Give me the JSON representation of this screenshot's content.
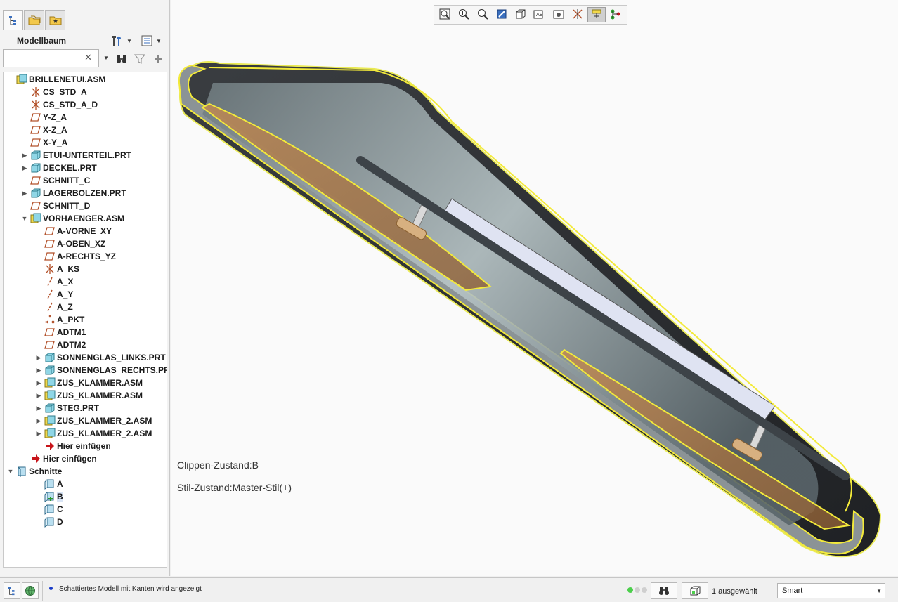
{
  "panel": {
    "title": "Modellbaum",
    "search": {
      "value": "",
      "placeholder": ""
    }
  },
  "tree": [
    {
      "label": "BRILLENETUI.ASM",
      "icon": "assembly",
      "depth": 0,
      "toggle": ""
    },
    {
      "label": "CS_STD_A",
      "icon": "csys",
      "depth": 1,
      "toggle": ""
    },
    {
      "label": "CS_STD_A_D",
      "icon": "csys",
      "depth": 1,
      "toggle": ""
    },
    {
      "label": "Y-Z_A",
      "icon": "datum-plane",
      "depth": 1,
      "toggle": ""
    },
    {
      "label": "X-Z_A",
      "icon": "datum-plane",
      "depth": 1,
      "toggle": ""
    },
    {
      "label": "X-Y_A",
      "icon": "datum-plane",
      "depth": 1,
      "toggle": ""
    },
    {
      "label": "ETUI-UNTERTEIL.PRT",
      "icon": "part",
      "depth": 1,
      "toggle": "collapsed"
    },
    {
      "label": "DECKEL.PRT",
      "icon": "part",
      "depth": 1,
      "toggle": "collapsed"
    },
    {
      "label": "SCHNITT_C",
      "icon": "datum-plane",
      "depth": 1,
      "toggle": ""
    },
    {
      "label": "LAGERBOLZEN.PRT",
      "icon": "part",
      "depth": 1,
      "toggle": "collapsed"
    },
    {
      "label": "SCHNITT_D",
      "icon": "datum-plane",
      "depth": 1,
      "toggle": ""
    },
    {
      "label": "VORHAENGER.ASM",
      "icon": "assembly",
      "depth": 1,
      "toggle": "expanded"
    },
    {
      "label": "A-VORNE_XY",
      "icon": "datum-plane",
      "depth": 2,
      "toggle": ""
    },
    {
      "label": "A-OBEN_XZ",
      "icon": "datum-plane",
      "depth": 2,
      "toggle": ""
    },
    {
      "label": "A-RECHTS_YZ",
      "icon": "datum-plane",
      "depth": 2,
      "toggle": ""
    },
    {
      "label": "A_KS",
      "icon": "csys",
      "depth": 2,
      "toggle": ""
    },
    {
      "label": "A_X",
      "icon": "axis",
      "depth": 2,
      "toggle": ""
    },
    {
      "label": "A_Y",
      "icon": "axis",
      "depth": 2,
      "toggle": ""
    },
    {
      "label": "A_Z",
      "icon": "axis",
      "depth": 2,
      "toggle": ""
    },
    {
      "label": "A_PKT",
      "icon": "point",
      "depth": 2,
      "toggle": ""
    },
    {
      "label": "ADTM1",
      "icon": "datum-plane",
      "depth": 2,
      "toggle": ""
    },
    {
      "label": "ADTM2",
      "icon": "datum-plane",
      "depth": 2,
      "toggle": ""
    },
    {
      "label": "SONNENGLAS_LINKS.PRT",
      "icon": "part",
      "depth": 2,
      "toggle": "collapsed"
    },
    {
      "label": "SONNENGLAS_RECHTS.PRT",
      "icon": "part",
      "depth": 2,
      "toggle": "collapsed"
    },
    {
      "label": "ZUS_KLAMMER.ASM",
      "icon": "assembly",
      "depth": 2,
      "toggle": "collapsed"
    },
    {
      "label": "ZUS_KLAMMER.ASM",
      "icon": "assembly",
      "depth": 2,
      "toggle": "collapsed"
    },
    {
      "label": "STEG.PRT",
      "icon": "part",
      "depth": 2,
      "toggle": "collapsed"
    },
    {
      "label": "ZUS_KLAMMER_2.ASM",
      "icon": "assembly",
      "depth": 2,
      "toggle": "collapsed"
    },
    {
      "label": "ZUS_KLAMMER_2.ASM",
      "icon": "assembly",
      "depth": 2,
      "toggle": "collapsed"
    },
    {
      "label": "Hier einfügen",
      "icon": "insert-arrow",
      "depth": 2,
      "toggle": ""
    },
    {
      "label": "Hier einfügen",
      "icon": "insert-arrow",
      "depth": 1,
      "toggle": ""
    },
    {
      "label": "Schnitte",
      "icon": "section-folder",
      "depth": 0,
      "toggle": "expanded"
    },
    {
      "label": "A",
      "icon": "section",
      "depth": 2,
      "toggle": ""
    },
    {
      "label": "B",
      "icon": "section-active",
      "depth": 2,
      "toggle": ""
    },
    {
      "label": "C",
      "icon": "section",
      "depth": 2,
      "toggle": ""
    },
    {
      "label": "D",
      "icon": "section",
      "depth": 2,
      "toggle": ""
    }
  ],
  "viewport": {
    "clip_state": "Clippen-Zustand:B",
    "style_state": "Stil-Zustand:Master-Stil(+)",
    "toolbar": [
      "refit-icon",
      "zoom-in-icon",
      "zoom-out-icon",
      "repaint-icon",
      "display-style-icon",
      "saved-views-icon",
      "perspective-icon",
      "datum-display-icon",
      "spin-center-icon",
      "annotation-display-icon"
    ]
  },
  "status": {
    "message": "Schattiertes Modell mit Kanten wird angezeigt",
    "selected": "1 ausgewählt",
    "filter": "Smart"
  },
  "colors": {
    "highlight": "#f3ea3a",
    "lens": "#b07a48",
    "body_dark": "#2e3033",
    "plate": "#dfe3f2"
  }
}
